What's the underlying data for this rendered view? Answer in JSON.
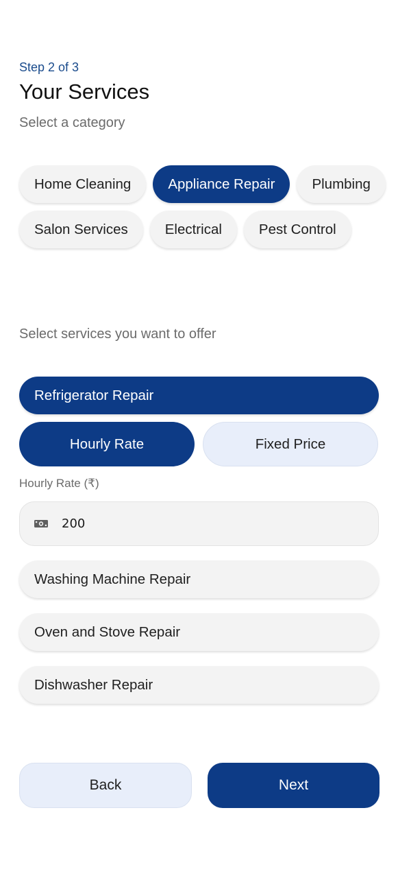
{
  "header": {
    "step": "Step 2 of 3",
    "title": "Your Services",
    "subtitle": "Select a category"
  },
  "categories": [
    {
      "label": "Home Cleaning",
      "selected": false
    },
    {
      "label": "Appliance Repair",
      "selected": true
    },
    {
      "label": "Plumbing",
      "selected": false
    },
    {
      "label": "Salon Services",
      "selected": false
    },
    {
      "label": "Electrical",
      "selected": false
    },
    {
      "label": "Pest Control",
      "selected": false
    }
  ],
  "services_section": {
    "label": "Select services you want to offer",
    "services": [
      {
        "label": "Refrigerator Repair",
        "selected": true
      },
      {
        "label": "Washing Machine Repair",
        "selected": false
      },
      {
        "label": "Oven and Stove Repair",
        "selected": false
      },
      {
        "label": "Dishwasher Repair",
        "selected": false
      }
    ]
  },
  "pricing": {
    "options": [
      {
        "label": "Hourly Rate",
        "selected": true
      },
      {
        "label": "Fixed Price",
        "selected": false
      }
    ],
    "field_label": "Hourly Rate (₹)",
    "value": "200",
    "icon": "money-icon"
  },
  "actions": {
    "back_label": "Back",
    "next_label": "Next"
  },
  "colors": {
    "primary": "#0d3b86",
    "chip_bg": "#f3f3f3",
    "secondary_bg": "#e8eefa",
    "step_text": "#1a4b8c"
  }
}
